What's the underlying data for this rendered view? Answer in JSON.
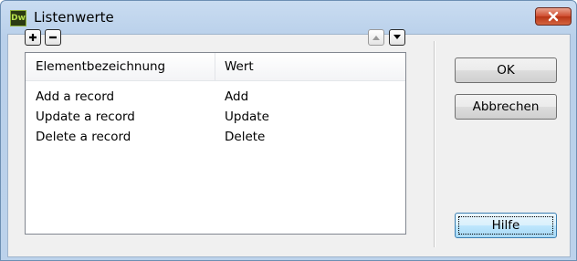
{
  "window": {
    "app_icon_text": "Dw",
    "title": "Listenwerte",
    "close_icon": "close-icon"
  },
  "toolbar": {
    "add_icon": "plus-icon",
    "remove_icon": "minus-icon",
    "move_up_icon": "arrow-up-icon",
    "move_down_icon": "arrow-down-icon"
  },
  "list": {
    "columns": [
      "Elementbezeichnung",
      "Wert"
    ],
    "rows": [
      [
        "Add a record",
        "Add"
      ],
      [
        "Update a record",
        "Update"
      ],
      [
        "Delete a record",
        "Delete"
      ]
    ]
  },
  "buttons": {
    "ok": "OK",
    "cancel": "Abbrechen",
    "help": "Hilfe"
  },
  "colors": {
    "frame": "#bcd2eb",
    "close": "#c7432a",
    "focus_border": "#3c7fb1"
  }
}
